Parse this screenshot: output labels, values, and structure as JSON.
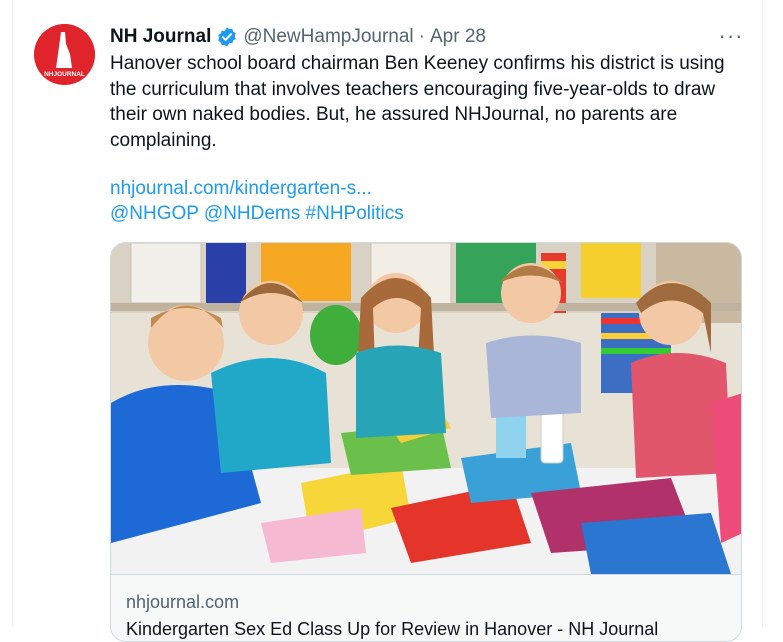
{
  "tweet": {
    "author_name": "NH Journal",
    "handle": "@NewHampJournal",
    "separator": "·",
    "date": "Apr 28",
    "more_label": "···",
    "text": "Hanover school board chairman Ben Keeney confirms his district is using the curriculum that involves teachers encouraging five-year-olds to draw their own naked bodies. But, he assured NHJournal, no parents are complaining.",
    "link": "nhjournal.com/kindergarten-s...",
    "tags": [
      "@NHGOP",
      "@NHDems",
      "#NHPolitics"
    ],
    "avatar_label": "NHJOURNAL",
    "verified_color": "#1d9bf0",
    "brand_color": "#e0242b"
  },
  "card": {
    "domain": "nhjournal.com",
    "title": "Kindergarten Sex Ed Class Up for Review in Hanover - NH Journal"
  },
  "icons": {
    "verified": "verified-badge-icon",
    "more": "more-options-icon"
  }
}
